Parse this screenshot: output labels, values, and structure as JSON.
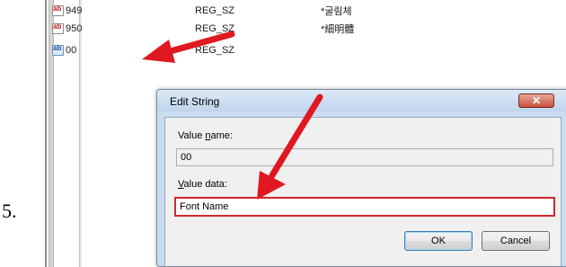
{
  "step_number": "5.",
  "registry_rows": [
    {
      "name": "949",
      "type": "REG_SZ",
      "data": "*굴림체",
      "icon": "string-value-icon"
    },
    {
      "name": "950",
      "type": "REG_SZ",
      "data": "*細明體",
      "icon": "string-value-icon"
    },
    {
      "name": "00",
      "type": "REG_SZ",
      "data": "",
      "icon": "string-value-icon"
    }
  ],
  "dialog": {
    "title": "Edit String",
    "close_glyph": "✕",
    "value_name_label_u": "n",
    "value_name_label_pre": "Value ",
    "value_name_label_post": "ame:",
    "value_name": "00",
    "value_data_label_u": "V",
    "value_data_label_post": "alue data:",
    "value_data": "Font Name",
    "ok_label": "OK",
    "cancel_label": "Cancel"
  },
  "colors": {
    "arrow": "#e0181f",
    "highlight_border": "#d2262a",
    "dialog_frame": "#c9dcf0"
  }
}
